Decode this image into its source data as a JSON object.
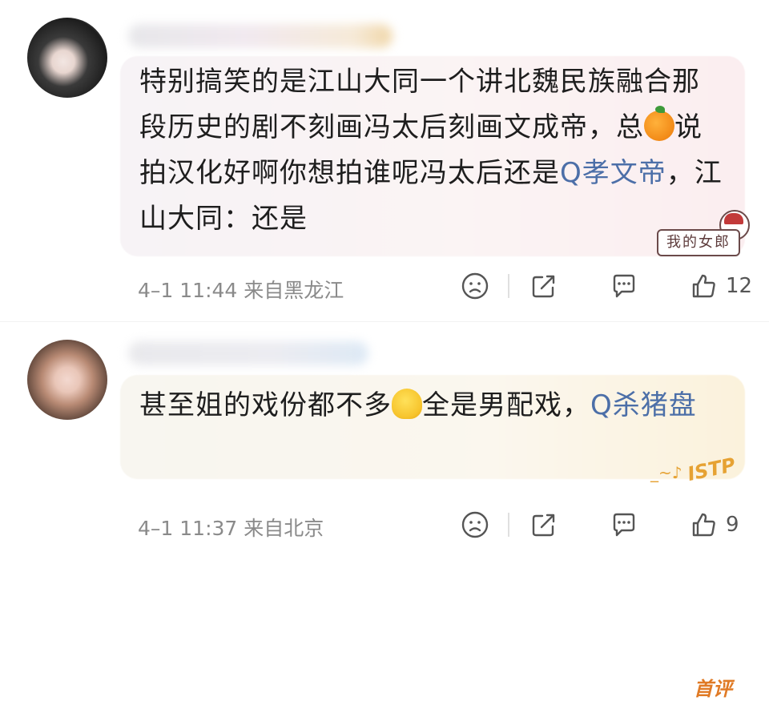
{
  "comments": [
    {
      "text_before": "特别搞笑的是江山大同一个讲北魏民族融合那段历史的剧不刻画冯太后刻画文成帝，总",
      "emoji_1": "orange-emoji",
      "text_middle": "说拍汉化好啊你想拍谁呢冯太后还是",
      "search_link": "Q孝文帝",
      "text_after": "，江山大同：还是",
      "timestamp": "4–1 11:44",
      "location": "来自黑龙江",
      "like_count": "12",
      "badge_text": "我的女郎"
    },
    {
      "text_before": "甚至姐的戏份都不多",
      "emoji_1": "melting-face-emoji",
      "text_middle": "全是男配戏，",
      "search_link": "Q杀猪盘",
      "timestamp": "4–1 11:37",
      "location": "来自北京",
      "like_count": "9",
      "badge_text": "首评",
      "deco_text": "ISTP",
      "deco_wave": "_~♪"
    }
  ],
  "colors": {
    "link": "#4c6fa8",
    "meta": "#8a8a8a",
    "first_badge": "#e07a25"
  },
  "icons": [
    "sad-face-icon",
    "share-icon",
    "comment-icon",
    "like-icon"
  ]
}
